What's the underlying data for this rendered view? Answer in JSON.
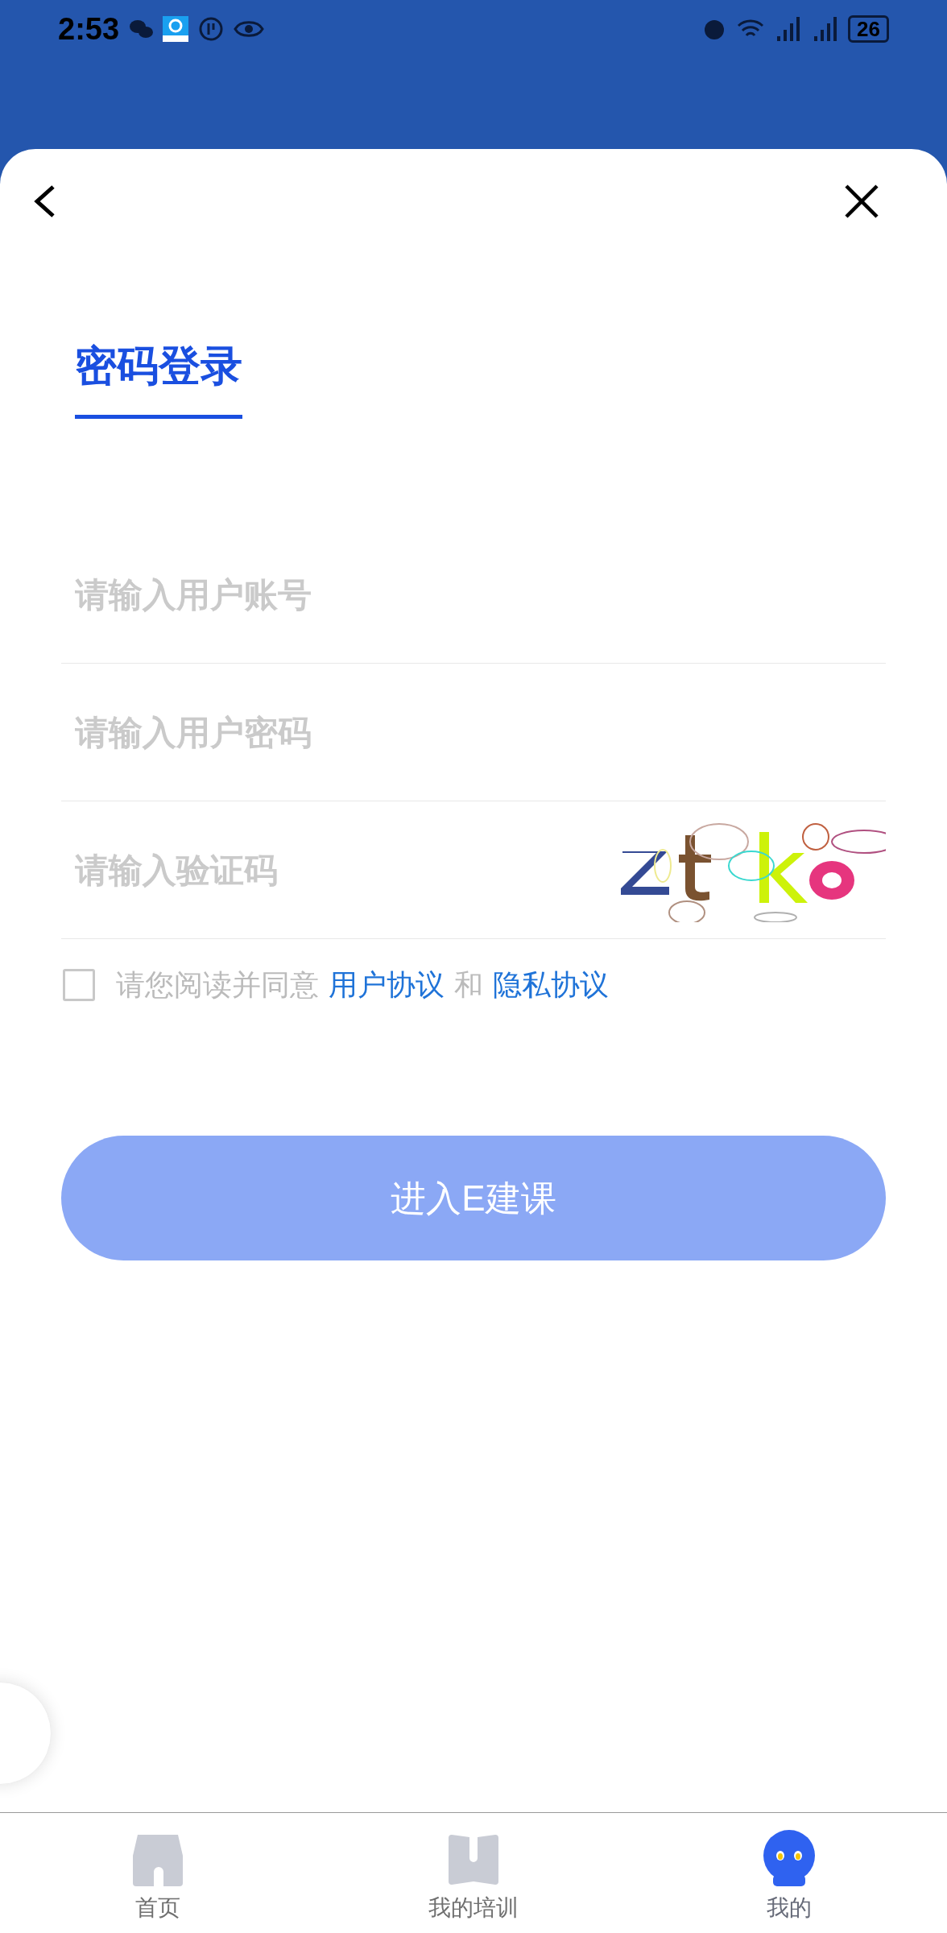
{
  "status_bar": {
    "time": "2:53",
    "battery": "26"
  },
  "tabs": [
    {
      "label": "密码登录",
      "selected": true
    }
  ],
  "fields": [
    {
      "kind": "text",
      "placeholder": "请输入用户账号"
    },
    {
      "kind": "password",
      "placeholder": "请输入用户密码"
    },
    {
      "kind": "captcha",
      "placeholder": "请输入验证码"
    }
  ],
  "agreement": {
    "checked": false,
    "prefix": "请您阅读并同意",
    "link_1": "用户协议",
    "joiner": "和",
    "link_2": "隐私协议"
  },
  "submit": {
    "label": "进入E建课",
    "disabled": true
  },
  "bottom_nav": [
    {
      "label": "首页",
      "selected": false
    },
    {
      "label": "我的培训",
      "selected": false
    },
    {
      "label": "我的",
      "selected": true
    }
  ]
}
